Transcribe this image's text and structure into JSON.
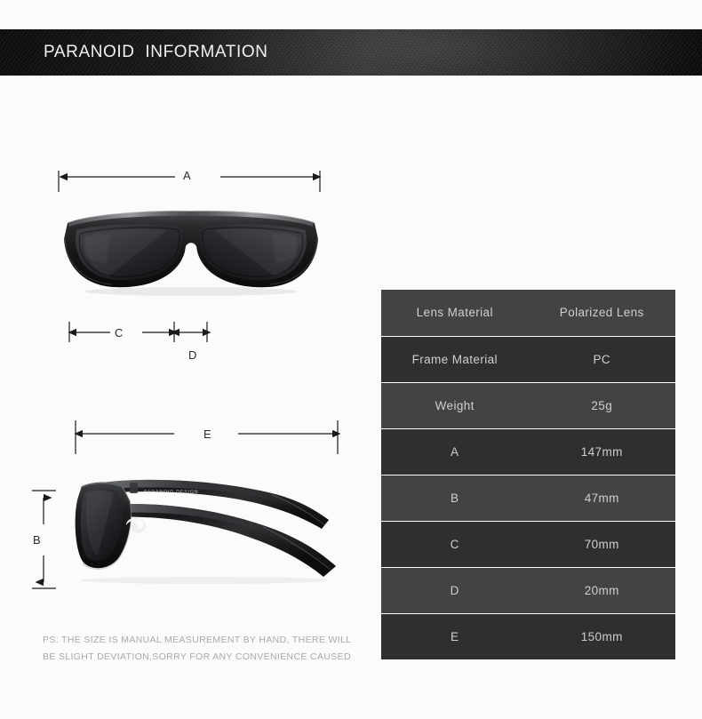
{
  "banner": {
    "title": "PARANOID  INFORMATION"
  },
  "diagram": {
    "front_view_alt": "sunglasses-front-view",
    "side_view_alt": "sunglasses-side-view",
    "temple_brand_text": "PARANOID DESIGN",
    "labels": {
      "a": "A",
      "b": "B",
      "c": "C",
      "d": "D",
      "e": "E"
    }
  },
  "disclaimer": {
    "line1": "PS: THE SIZE IS MANUAL MEASUREMENT BY HAND, THERE WILL",
    "line2": "BE SLIGHT DEVIATION,SORRY FOR ANY CONVENIENCE CAUSED"
  },
  "spec_table": {
    "rows": [
      {
        "key": "Lens Material",
        "value": "Polarized Lens"
      },
      {
        "key": "Frame Material",
        "value": "PC"
      },
      {
        "key": "Weight",
        "value": "25g"
      },
      {
        "key": "A",
        "value": "147mm"
      },
      {
        "key": "B",
        "value": "47mm"
      },
      {
        "key": "C",
        "value": "70mm"
      },
      {
        "key": "D",
        "value": "20mm"
      },
      {
        "key": "E",
        "value": "150mm"
      }
    ]
  },
  "colors": {
    "page_background": "#fbfbfb",
    "banner_dark": "#141414",
    "banner_text": "#f2f2f2",
    "table_row_light": "#434343",
    "table_row_dark": "#2f2f2f",
    "table_text": "#cfcfcf",
    "table_divider": "#ffffff",
    "disclaimer_text": "#a9a9a9",
    "dimension_line": "#1a1a1a"
  }
}
